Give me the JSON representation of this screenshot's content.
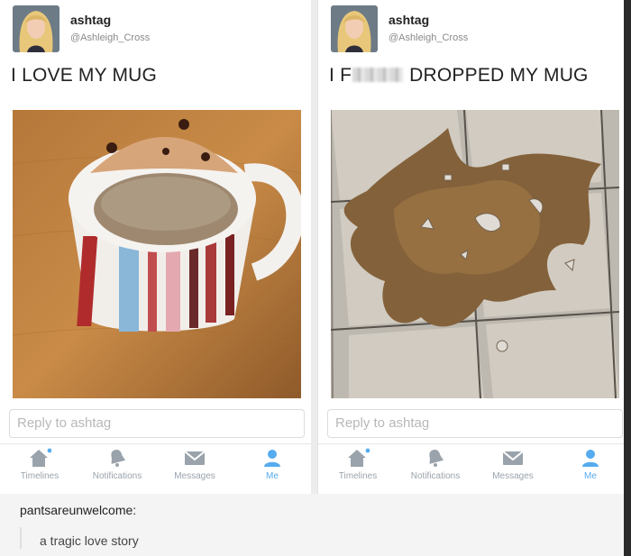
{
  "left": {
    "display_name": "ashtag",
    "handle": "@Ashleigh_Cross",
    "tweet_text": "I LOVE MY MUG",
    "reply_placeholder": "Reply to ashtag",
    "tabs": [
      {
        "label": "Timelines",
        "icon": "home-icon"
      },
      {
        "label": "Notifications",
        "icon": "bell-icon"
      },
      {
        "label": "Messages",
        "icon": "envelope-icon"
      },
      {
        "label": "Me",
        "icon": "person-icon"
      }
    ]
  },
  "right": {
    "display_name": "ashtag",
    "handle": "@Ashleigh_Cross",
    "tweet_text_start": "I F",
    "tweet_text_end": "DROPPED MY MUG",
    "reply_placeholder": "Reply to ashtag",
    "tabs": [
      {
        "label": "Timelines",
        "icon": "home-icon"
      },
      {
        "label": "Notifications",
        "icon": "bell-icon"
      },
      {
        "label": "Messages",
        "icon": "envelope-icon"
      },
      {
        "label": "Me",
        "icon": "person-icon"
      }
    ]
  },
  "comment": {
    "username": "pantsareunwelcome:",
    "text": "a tragic love story"
  },
  "colors": {
    "accent": "#55acee",
    "tab_inactive": "#9aa3ab"
  }
}
